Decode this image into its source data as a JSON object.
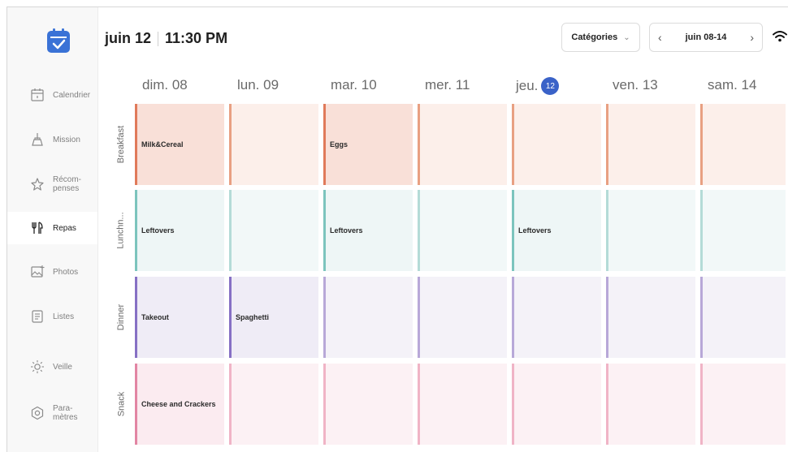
{
  "header": {
    "date": "juin 12",
    "time": "11:30 PM",
    "categories_label": "Catégories",
    "week_label": "juin 08-14"
  },
  "sidebar": {
    "items": [
      {
        "label": "Calendrier",
        "icon": "calendar-icon"
      },
      {
        "label": "Mission",
        "icon": "broom-icon"
      },
      {
        "label": "Récom-\npenses",
        "icon": "star-icon"
      },
      {
        "label": "Repas",
        "icon": "utensils-icon",
        "active": true
      },
      {
        "label": "Photos",
        "icon": "photo-icon"
      },
      {
        "label": "Listes",
        "icon": "list-icon"
      },
      {
        "label": "Veille",
        "icon": "sun-icon"
      },
      {
        "label": "Para-\nmètres",
        "icon": "gear-icon"
      }
    ]
  },
  "days": [
    {
      "label": "dim. 08"
    },
    {
      "label": "lun. 09"
    },
    {
      "label": "mar. 10"
    },
    {
      "label": "mer. 11"
    },
    {
      "label": "jeu.",
      "badge": "12",
      "today": true
    },
    {
      "label": "ven. 13"
    },
    {
      "label": "sam. 14"
    }
  ],
  "meals": [
    {
      "label": "Breakfast",
      "bg": "#fcefea",
      "bar": "#e8a082",
      "bar_filled": "#e07a5a",
      "filled_bg": "#f9e0d8",
      "cells": [
        "Milk&Cereal",
        "",
        "Eggs",
        "",
        "",
        "",
        ""
      ]
    },
    {
      "label": "Lunchn...",
      "bg": "#f2f8f8",
      "bar": "#b4dbd7",
      "bar_filled": "#7cc4bd",
      "filled_bg": "#eef6f6",
      "cells": [
        "Leftovers",
        "",
        "Leftovers",
        "",
        "Leftovers",
        "",
        ""
      ]
    },
    {
      "label": "Dinner",
      "bg": "#f4f2f8",
      "bar": "#b8a8d8",
      "bar_filled": "#8670c4",
      "filled_bg": "#efecf6",
      "cells": [
        "Takeout",
        "Spaghetti",
        "",
        "",
        "",
        "",
        ""
      ]
    },
    {
      "label": "Snack",
      "bg": "#fcf1f4",
      "bar": "#f0b4c6",
      "bar_filled": "#e285a3",
      "filled_bg": "#fbebf0",
      "cells": [
        "Cheese and Crackers",
        "",
        "",
        "",
        "",
        "",
        ""
      ]
    }
  ]
}
